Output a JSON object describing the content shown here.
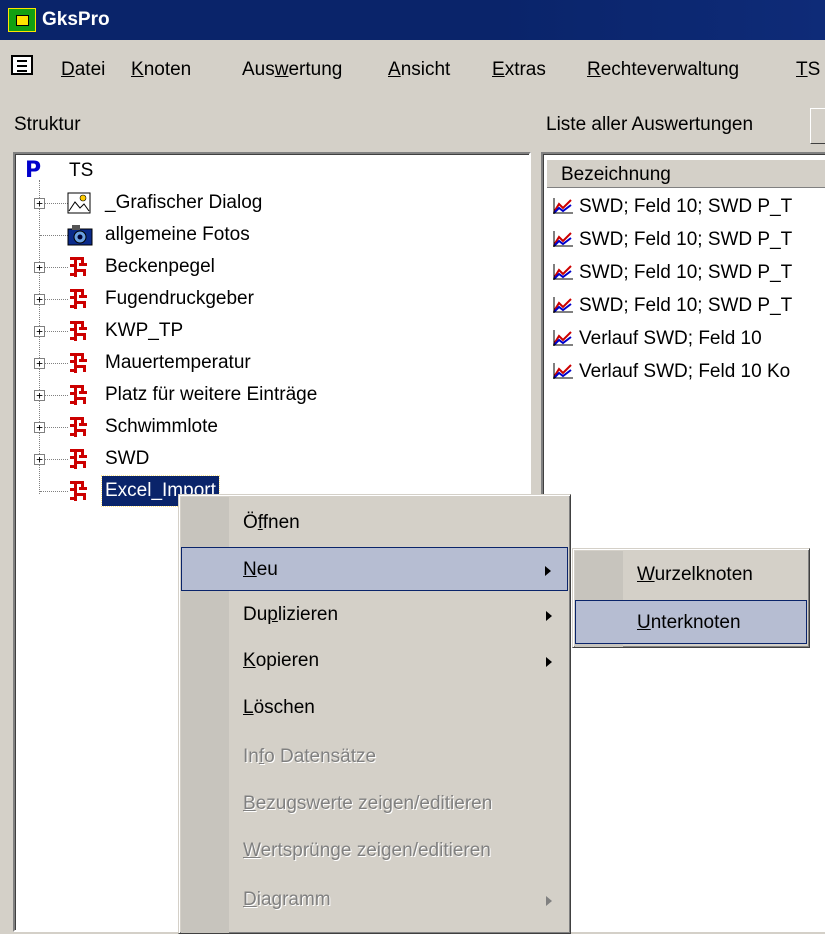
{
  "window": {
    "title": "GksPro"
  },
  "menubar": {
    "items": [
      {
        "label": "Datei",
        "accel": "D",
        "rest": "atei"
      },
      {
        "label": "Knoten",
        "accel": "K",
        "rest": "noten"
      },
      {
        "label": "Auswertung",
        "pre": "Aus",
        "accel": "w",
        "rest": "ertung"
      },
      {
        "label": "Ansicht",
        "accel": "A",
        "rest": "nsicht"
      },
      {
        "label": "Extras",
        "accel": "E",
        "rest": "xtras"
      },
      {
        "label": "Rechteverwaltung",
        "accel": "R",
        "rest": "echteverwaltung"
      },
      {
        "label": "TS",
        "accel": "T",
        "rest": "S"
      }
    ]
  },
  "panels": {
    "struktur_label": "Struktur",
    "liste_label": "Liste aller Auswertungen"
  },
  "tree": {
    "root": {
      "label": "TS",
      "icon": "project-p-icon"
    },
    "items": [
      {
        "label": "_Grafischer Dialog",
        "icon": "image-icon",
        "expandable": true
      },
      {
        "label": "allgemeine Fotos",
        "icon": "camera-icon",
        "expandable": false
      },
      {
        "label": "Beckenpegel",
        "icon": "node-tree-icon",
        "expandable": true
      },
      {
        "label": "Fugendruckgeber",
        "icon": "node-tree-icon",
        "expandable": true
      },
      {
        "label": "KWP_TP",
        "icon": "node-tree-icon",
        "expandable": true
      },
      {
        "label": "Mauertemperatur",
        "icon": "node-tree-icon",
        "expandable": true
      },
      {
        "label": "Platz für weitere Einträge",
        "icon": "node-tree-icon",
        "expandable": true
      },
      {
        "label": "Schwimmlote",
        "icon": "node-tree-icon",
        "expandable": true
      },
      {
        "label": "SWD",
        "icon": "node-tree-icon",
        "expandable": true
      },
      {
        "label": "Excel_Import",
        "icon": "node-tree-icon",
        "expandable": false,
        "selected": true
      }
    ]
  },
  "list": {
    "header": "Bezeichnung",
    "rows": [
      "SWD; Feld 10; SWD P_T",
      "SWD; Feld 10; SWD P_T",
      "SWD; Feld 10; SWD P_T",
      "SWD; Feld 10; SWD P_T",
      "Verlauf SWD; Feld 10",
      "Verlauf SWD; Feld 10 Ko"
    ]
  },
  "context_menu": {
    "items": [
      {
        "label": "Öffnen",
        "pre": "Ö",
        "accel": "f",
        "rest": "fnen",
        "enabled": true,
        "submenu": false
      },
      {
        "label": "Neu",
        "accel": "N",
        "rest": "eu",
        "enabled": true,
        "submenu": true,
        "highlighted": true
      },
      {
        "label": "Duplizieren",
        "pre": "Du",
        "accel": "p",
        "rest": "lizieren",
        "enabled": true,
        "submenu": true
      },
      {
        "label": "Kopieren",
        "accel": "K",
        "rest": "opieren",
        "enabled": true,
        "submenu": true
      },
      {
        "label": "Löschen",
        "accel": "L",
        "rest": "öschen",
        "enabled": true,
        "submenu": false
      },
      {
        "label": "Info Datensätze",
        "pre": "In",
        "accel": "f",
        "rest": "o Datensätze",
        "enabled": false,
        "submenu": false
      },
      {
        "label": "Bezugswerte zeigen/editieren",
        "accel": "B",
        "rest": "ezugswerte zeigen/editieren",
        "enabled": false,
        "submenu": false
      },
      {
        "label": "Wertsprünge zeigen/editieren",
        "accel": "W",
        "rest": "ertsprünge zeigen/editieren",
        "enabled": false,
        "submenu": false
      },
      {
        "label": "Diagramm",
        "accel": "D",
        "rest": "iagramm",
        "enabled": false,
        "submenu": true
      }
    ]
  },
  "submenu": {
    "items": [
      {
        "label": "Wurzelknoten",
        "accel": "W",
        "rest": "urzelknoten"
      },
      {
        "label": "Unterknoten",
        "accel": "U",
        "rest": "nterknoten",
        "highlighted": true
      }
    ]
  },
  "colors": {
    "titlebar": "#0a246a",
    "face": "#d4d0c8",
    "highlight": "#b6bdd2",
    "node_red": "#cc0000"
  }
}
